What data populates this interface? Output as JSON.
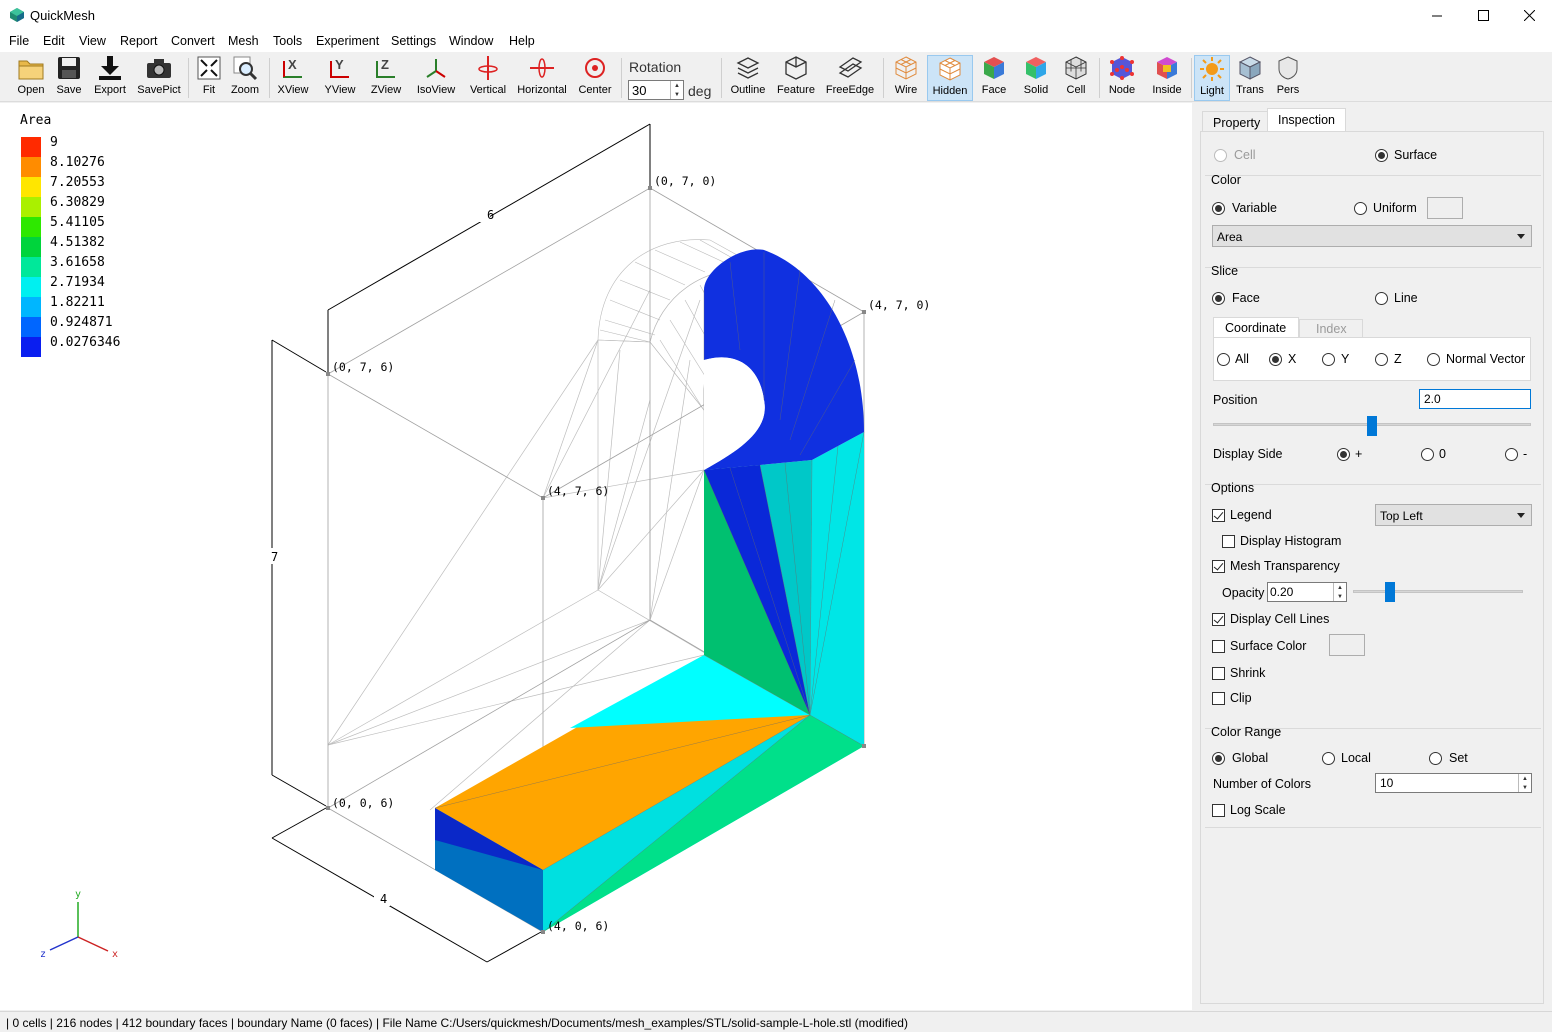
{
  "window": {
    "title": "QuickMesh"
  },
  "menu": [
    "File",
    "Edit",
    "View",
    "Report",
    "Convert",
    "Mesh",
    "Tools",
    "Experiment",
    "Settings",
    "Window",
    "Help"
  ],
  "toolbar": {
    "open": "Open",
    "save": "Save",
    "export": "Export",
    "savepict": "SavePict",
    "fit": "Fit",
    "zoom": "Zoom",
    "xview": "XView",
    "yview": "YView",
    "zview": "ZView",
    "isoview": "IsoView",
    "vertical": "Vertical",
    "horizontal": "Horizontal",
    "center": "Center",
    "rotation_label": "Rotation",
    "rotation_value": "30",
    "rotation_unit": "deg",
    "outline": "Outline",
    "feature": "Feature",
    "freeedge": "FreeEdge",
    "wire": "Wire",
    "hidden": "Hidden",
    "face": "Face",
    "solid": "Solid",
    "cell": "Cell",
    "node": "Node",
    "inside": "Inside",
    "light": "Light",
    "trans": "Trans",
    "pers": "Pers"
  },
  "legend": {
    "title": "Area",
    "values": [
      "9",
      "8.10276",
      "7.20553",
      "6.30829",
      "5.41105",
      "4.51382",
      "3.61658",
      "2.71934",
      "1.82211",
      "0.924871",
      "0.0276346"
    ],
    "colors": [
      "#ff2a00",
      "#ff8c00",
      "#ffe600",
      "#aaf000",
      "#2ee800",
      "#00d43c",
      "#00e89a",
      "#00f0f0",
      "#00b6ff",
      "#0066ff",
      "#0a1ef0"
    ]
  },
  "viewport": {
    "corner_labels": [
      "(0, 7, 0)",
      "(4, 7, 0)",
      "(0, 7, 6)",
      "(4, 7, 6)",
      "(0, 0, 6)",
      "(4, 0, 6)"
    ],
    "dims": {
      "x": "4",
      "y": "7",
      "z": "6"
    },
    "axes": {
      "x": "x",
      "y": "y",
      "z": "z"
    }
  },
  "panel": {
    "tabs": [
      "Property",
      "Inspection"
    ],
    "cell": "Cell",
    "surface": "Surface",
    "color": {
      "title": "Color",
      "variable": "Variable",
      "uniform": "Uniform",
      "variable_select": "Area"
    },
    "slice": {
      "title": "Slice",
      "face": "Face",
      "line": "Line",
      "subtabs": [
        "Coordinate",
        "Index"
      ],
      "coords": [
        "All",
        "X",
        "Y",
        "Z",
        "Normal Vector"
      ],
      "position_label": "Position",
      "position_value": "2.0",
      "position_fraction": 0.5,
      "display_side_label": "Display Side",
      "sides": [
        "+",
        "0",
        "-"
      ]
    },
    "options": {
      "title": "Options",
      "legend": "Legend",
      "legend_position": "Top Left",
      "display_histogram": "Display Histogram",
      "mesh_transparency": "Mesh Transparency",
      "opacity_label": "Opacity",
      "opacity_value": "0.20",
      "display_cell_lines": "Display Cell Lines",
      "surface_color": "Surface Color",
      "shrink": "Shrink",
      "clip": "Clip"
    },
    "color_range": {
      "title": "Color Range",
      "global": "Global",
      "local": "Local",
      "set": "Set",
      "number_of_colors_label": "Number of Colors",
      "number_of_colors": "10",
      "log_scale": "Log Scale"
    }
  },
  "status": "| 0 cells | 216 nodes | 412 boundary faces |  boundary Name  (0 faces) | File Name C:/Users/quickmesh/Documents/mesh_examples/STL/solid-sample-L-hole.stl (modified)"
}
